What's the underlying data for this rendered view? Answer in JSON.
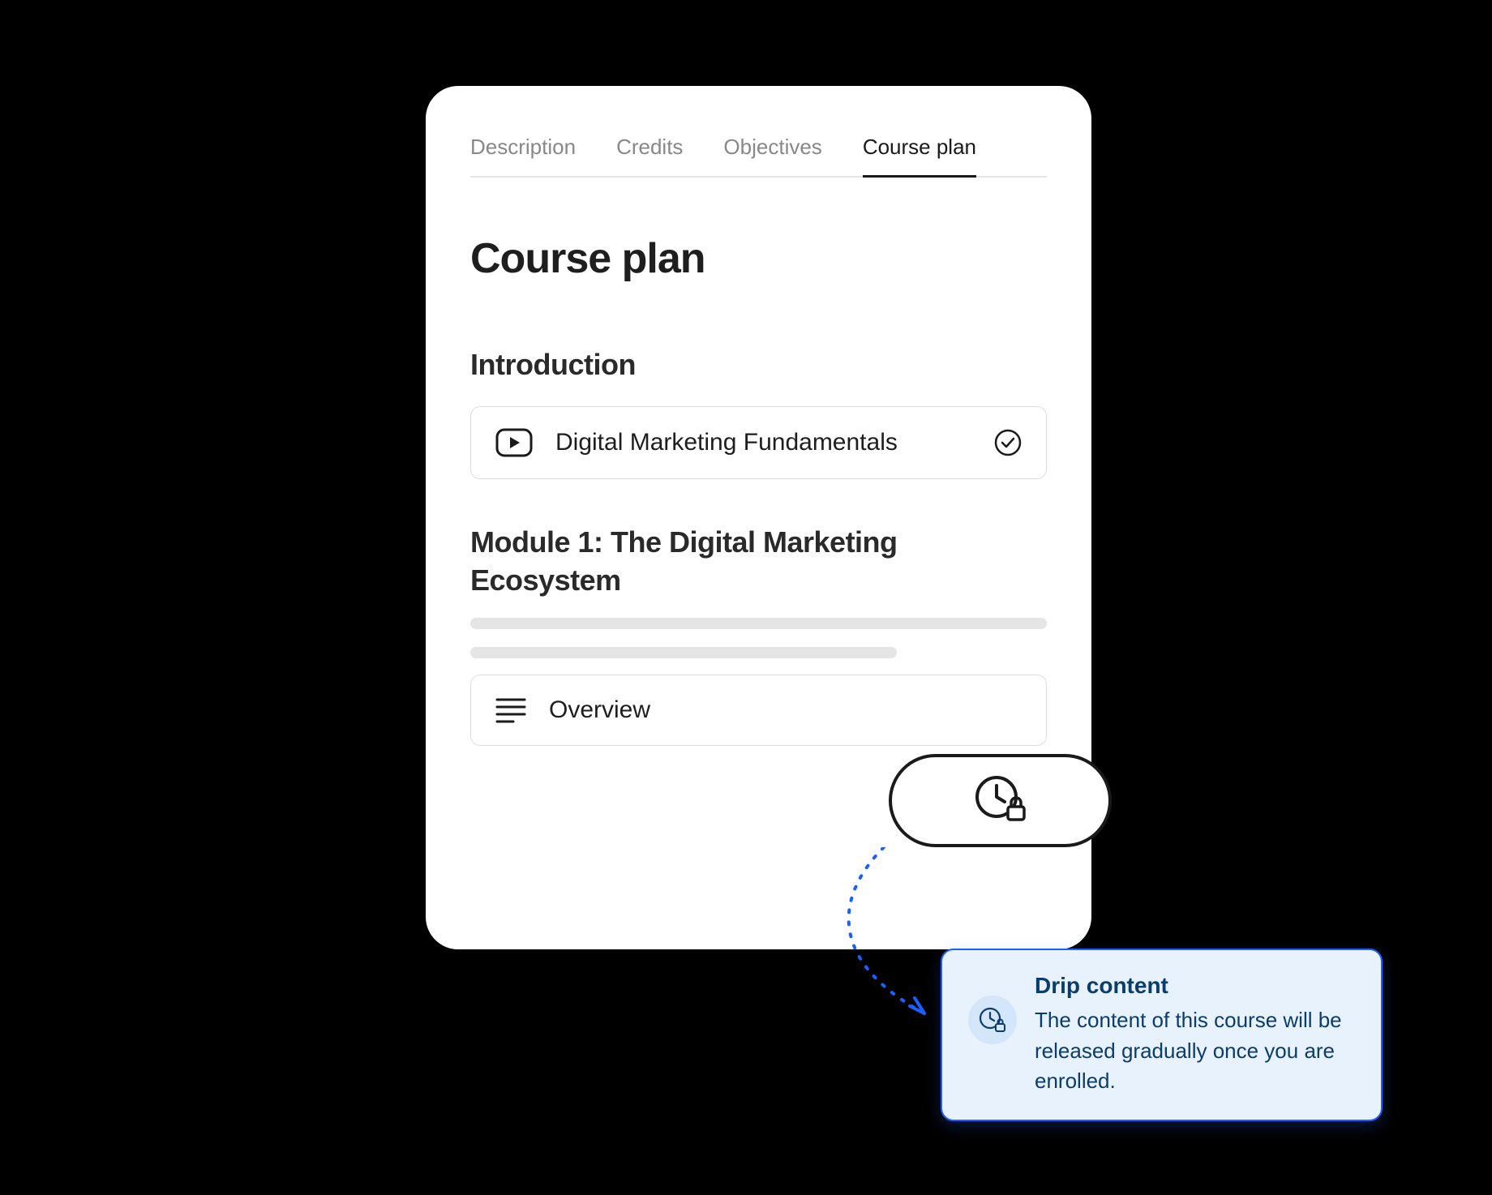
{
  "tabs": [
    {
      "label": "Description",
      "active": false
    },
    {
      "label": "Credits",
      "active": false
    },
    {
      "label": "Objectives",
      "active": false
    },
    {
      "label": "Course plan",
      "active": true
    }
  ],
  "page_title": "Course plan",
  "sections": [
    {
      "title": "Introduction",
      "lessons": [
        {
          "icon": "video-icon",
          "title": "Digital Marketing Fundamentals",
          "status": "complete"
        }
      ]
    },
    {
      "title": "Module 1: The Digital Marketing Ecosystem",
      "lessons": [
        {
          "icon": "text-icon",
          "title": "Overview",
          "status": "locked"
        }
      ]
    }
  ],
  "callout": {
    "icon": "clock-lock-icon"
  },
  "tooltip": {
    "icon": "clock-lock-icon",
    "title": "Drip content",
    "body": "The content of this course will be released gradually once you are enrolled."
  }
}
